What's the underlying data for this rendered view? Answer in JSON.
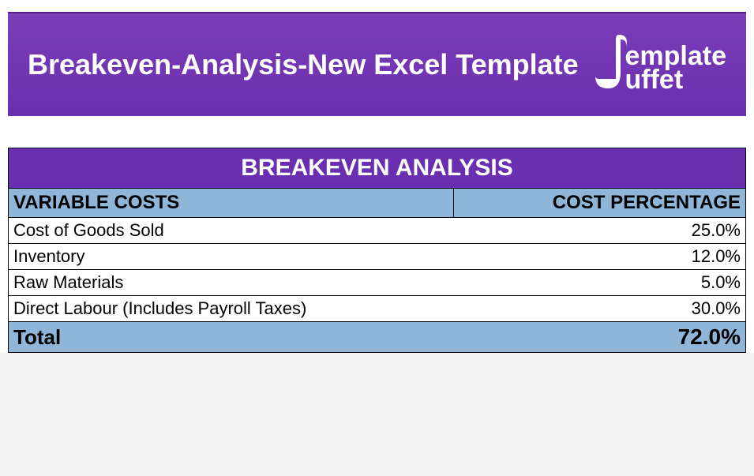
{
  "banner": {
    "title": "Breakeven-Analysis-New Excel Template",
    "logo_line1": "emplate",
    "logo_line2": "uffet"
  },
  "table": {
    "title": "BREAKEVEN ANALYSIS",
    "header_left": "VARIABLE COSTS",
    "header_right": "COST PERCENTAGE",
    "rows": [
      {
        "label": "Cost of Goods Sold",
        "value": "25.0%"
      },
      {
        "label": "Inventory",
        "value": "12.0%"
      },
      {
        "label": "Raw Materials",
        "value": "5.0%"
      },
      {
        "label": "Direct Labour (Includes Payroll Taxes)",
        "value": "30.0%"
      }
    ],
    "total_label": "Total",
    "total_value": "72.0%"
  },
  "chart_data": {
    "type": "table",
    "title": "BREAKEVEN ANALYSIS — Variable Costs",
    "categories": [
      "Cost of Goods Sold",
      "Inventory",
      "Raw Materials",
      "Direct Labour (Includes Payroll Taxes)"
    ],
    "values": [
      25.0,
      12.0,
      5.0,
      30.0
    ],
    "total": 72.0,
    "unit": "%"
  }
}
